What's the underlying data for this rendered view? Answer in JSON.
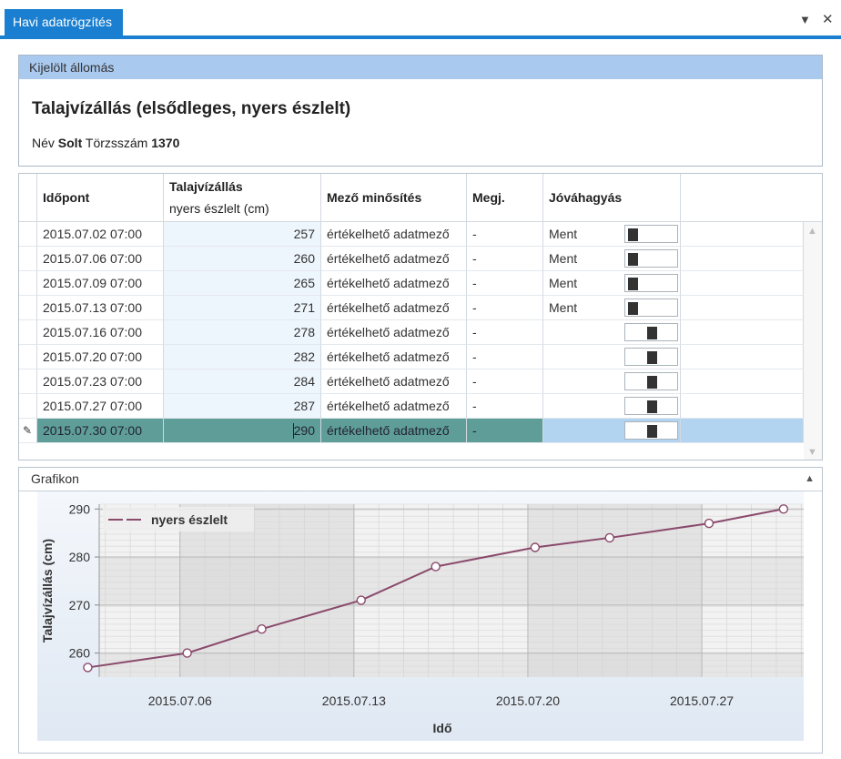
{
  "tab": {
    "title": "Havi adatrögzítés",
    "menu_icon": "dropdown-arrow-icon",
    "close_icon": "close-icon"
  },
  "station": {
    "header": "Kijelölt állomás",
    "title": "Talajvízállás (elsődleges, nyers észlelt)",
    "name_label": "Név",
    "name_value": "Solt",
    "id_label": "Törzsszám",
    "id_value": "1370"
  },
  "grid": {
    "columns": {
      "time": "Időpont",
      "level": "Talajvízállás",
      "level_sub": "nyers észlelt (cm)",
      "quality": "Mező minősítés",
      "note": "Megj.",
      "approval": "Jóváhagyás"
    },
    "rows": [
      {
        "time": "2015.07.02 07:00",
        "value": "257",
        "quality": "értékelhető adatmező",
        "note": "-",
        "approval": "Ment",
        "toggle": "left"
      },
      {
        "time": "2015.07.06 07:00",
        "value": "260",
        "quality": "értékelhető adatmező",
        "note": "-",
        "approval": "Ment",
        "toggle": "left"
      },
      {
        "time": "2015.07.09 07:00",
        "value": "265",
        "quality": "értékelhető adatmező",
        "note": "-",
        "approval": "Ment",
        "toggle": "left"
      },
      {
        "time": "2015.07.13 07:00",
        "value": "271",
        "quality": "értékelhető adatmező",
        "note": "-",
        "approval": "Ment",
        "toggle": "left"
      },
      {
        "time": "2015.07.16 07:00",
        "value": "278",
        "quality": "értékelhető adatmező",
        "note": "-",
        "approval": "",
        "toggle": "right"
      },
      {
        "time": "2015.07.20 07:00",
        "value": "282",
        "quality": "értékelhető adatmező",
        "note": "-",
        "approval": "",
        "toggle": "right"
      },
      {
        "time": "2015.07.23 07:00",
        "value": "284",
        "quality": "értékelhető adatmező",
        "note": "-",
        "approval": "",
        "toggle": "right"
      },
      {
        "time": "2015.07.27 07:00",
        "value": "287",
        "quality": "értékelhető adatmező",
        "note": "-",
        "approval": "",
        "toggle": "right"
      },
      {
        "time": "2015.07.30 07:00",
        "value": "290",
        "quality": "értékelhető adatmező",
        "note": "-",
        "approval": "",
        "toggle": "right",
        "selected": true
      }
    ]
  },
  "chart_panel": {
    "title": "Grafikon"
  },
  "chart_data": {
    "type": "line",
    "ylabel": "Talajvízállás (cm)",
    "xlabel": "Idő",
    "legend": "top-left",
    "series": [
      {
        "name": "nyers észlelt",
        "color": "#8a4a6c",
        "x": [
          "2015.07.02",
          "2015.07.06",
          "2015.07.09",
          "2015.07.13",
          "2015.07.16",
          "2015.07.20",
          "2015.07.23",
          "2015.07.27",
          "2015.07.30"
        ],
        "y": [
          257,
          260,
          265,
          271,
          278,
          282,
          284,
          287,
          290
        ]
      }
    ],
    "xticks": [
      "2015.07.06",
      "2015.07.13",
      "2015.07.20",
      "2015.07.27"
    ],
    "yticks": [
      260,
      270,
      280,
      290
    ],
    "xlim": [
      "2015.07.01",
      "2015.07.31"
    ],
    "ylim": [
      255,
      291
    ],
    "grid": true
  }
}
